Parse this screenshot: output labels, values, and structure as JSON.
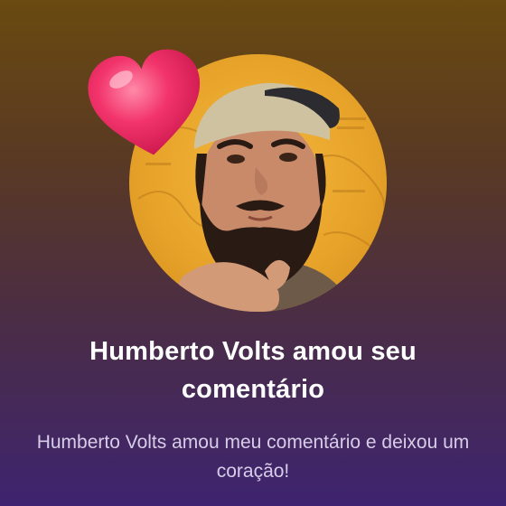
{
  "notification": {
    "title": "Humberto Volts amou seu comentário",
    "message": "Humberto Volts amou meu comentário e deixou um coração!"
  },
  "icons": {
    "reaction": "heart-icon"
  },
  "colors": {
    "background_top": "#6a4a10",
    "background_bottom": "#3e2470",
    "heart": "#f2346b",
    "avatar_background": "#e8a42a",
    "title_text": "#ffffff",
    "message_text": "#d8cde8"
  }
}
